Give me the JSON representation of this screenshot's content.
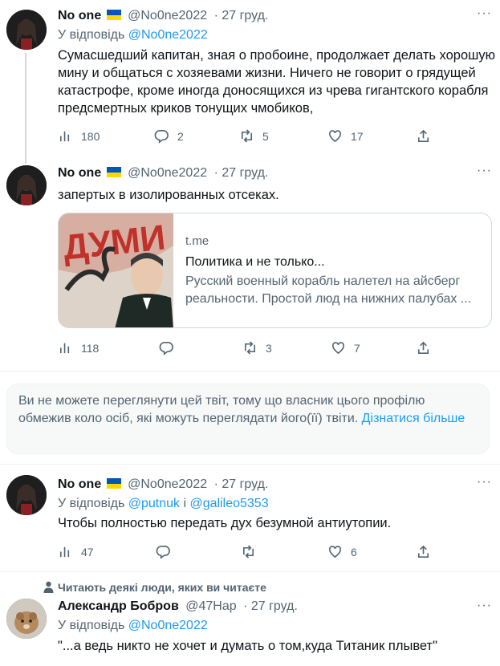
{
  "tweets": [
    {
      "author": "No one",
      "handle": "@No0ne2022",
      "date": "· 27 груд.",
      "reply_prefix": "У відповідь",
      "reply_to": "@No0ne2022",
      "text": "Сумасшедший капитан, зная о пробоине, продолжает делать хорошую мину и общаться с хозяевами жизни. Ничего не говорит о грядущей катастрофе, кроме иногда доносящихся из чрева гигантского корабля предсмертных криков тонущих чмобиков,",
      "stats": {
        "views": "180",
        "replies": "2",
        "retweets": "5",
        "likes": "17"
      }
    },
    {
      "author": "No one",
      "handle": "@No0ne2022",
      "date": "· 27 груд.",
      "text": "запертых в изолированных отсеках.",
      "card": {
        "image_text": "ДУМИ",
        "domain": "t.me",
        "title": "Политика и не только...",
        "description": "Русский военный корабль налетел на айсберг реальности. Простой люд на нижних палубах ..."
      },
      "stats": {
        "views": "118",
        "replies": "",
        "retweets": "3",
        "likes": "7"
      }
    },
    {
      "author": "No one",
      "handle": "@No0ne2022",
      "date": "· 27 груд.",
      "reply_prefix": "У відповідь",
      "reply_to_1": "@putnuk",
      "reply_join": "і",
      "reply_to_2": "@galileo5353",
      "text": "Чтобы полностью передать дух безумной антиутопии.",
      "stats": {
        "views": "47",
        "replies": "",
        "retweets": "",
        "likes": "6"
      }
    },
    {
      "social_context": "Читають деякі люди, яких ви читаєте",
      "author": "Александр Бобров",
      "handle": "@47Hap",
      "date": "· 27 груд.",
      "reply_prefix": "У відповідь",
      "reply_to": "@No0ne2022",
      "text": "\"...а ведь никто не хочет и думать о том,куда Титаник плывет\""
    }
  ],
  "notice": {
    "text": "Ви не можете переглянути цей твіт, тому що власник цього профілю обмежив коло осіб, які можуть переглядати його(її) твіти. ",
    "link": "Дізнатися більше"
  },
  "more_label": "···",
  "colors": {
    "accent": "#1d9bf0",
    "muted": "#536471",
    "text": "#0f1419",
    "border": "#cfd9de",
    "notice_bg": "#f7f9f9"
  },
  "icons": [
    "more-icon",
    "views-icon",
    "reply-icon",
    "retweet-icon",
    "like-icon",
    "share-icon",
    "person-icon",
    "ukraine-flag-icon"
  ]
}
